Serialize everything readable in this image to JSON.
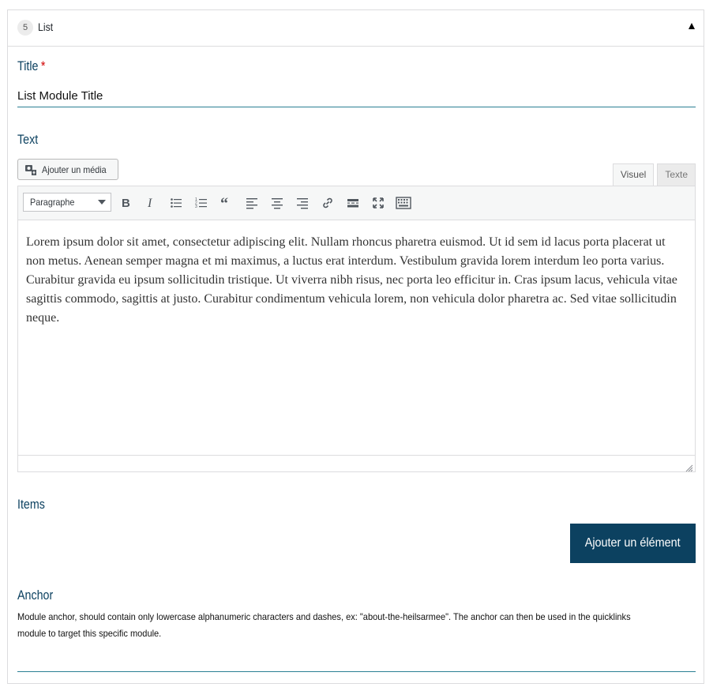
{
  "module": {
    "index": "5",
    "name": "List"
  },
  "title_field": {
    "label": "Title",
    "required_mark": "*",
    "value": "List Module Title"
  },
  "text_field": {
    "label": "Text",
    "add_media_label": "Ajouter un média",
    "tabs": [
      "Visuel",
      "Texte"
    ],
    "format_select": "Paragraphe",
    "toolbar_icons": [
      "bold-icon",
      "italic-icon",
      "bullet-list-icon",
      "numbered-list-icon",
      "blockquote-icon",
      "align-left-icon",
      "align-center-icon",
      "align-right-icon",
      "link-icon",
      "read-more-icon",
      "fullscreen-icon",
      "toolbar-toggle-icon"
    ],
    "content": "Lorem ipsum dolor sit amet, consectetur adipiscing elit. Nullam rhoncus pharetra euismod. Ut id sem id lacus porta placerat ut non metus. Aenean semper magna et mi maximus, a luctus erat interdum. Vestibulum gravida lorem interdum leo porta varius. Curabitur gravida eu ipsum sollicitudin tristique. Ut viverra nibh risus, nec porta leo efficitur in. Cras ipsum lacus, vehicula vitae sagittis commodo, sagittis at justo. Curabitur condimentum vehicula lorem, non vehicula dolor pharetra ac. Sed vitae sollicitudin neque."
  },
  "items_field": {
    "label": "Items",
    "add_button_label": "Ajouter un élément"
  },
  "anchor_field": {
    "label": "Anchor",
    "description": "Module anchor, should contain only lowercase alphanumeric characters and dashes, ex: \"about-the-heilsarmee\". The anchor can then be used in the quicklinks module to target this specific module.",
    "value": ""
  },
  "colors": {
    "accent": "#0c4160",
    "underline": "#2b7f93",
    "required": "#d10000"
  }
}
